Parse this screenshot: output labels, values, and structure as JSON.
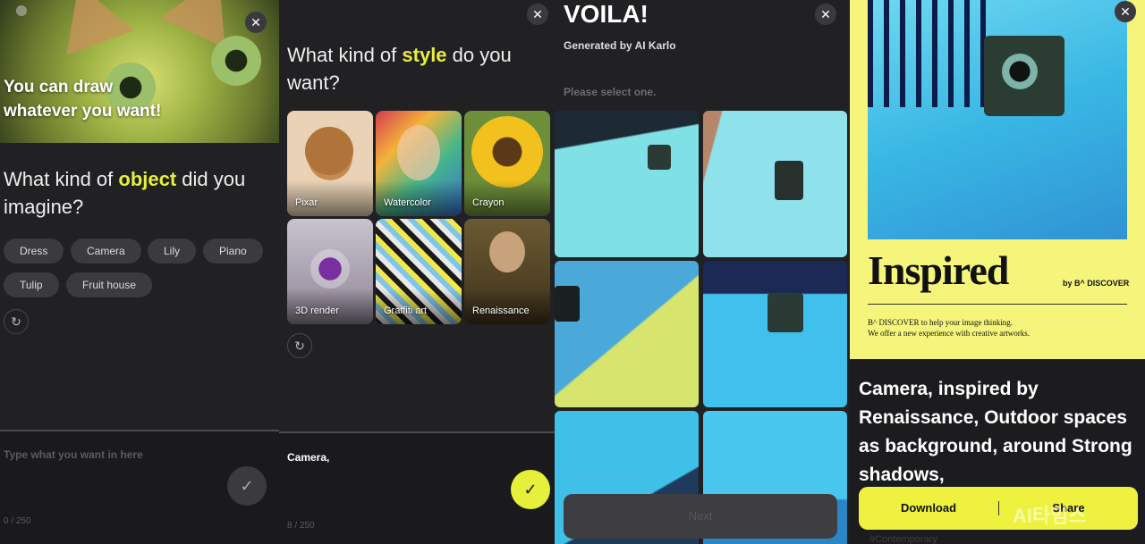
{
  "colors": {
    "accent": "#e6ef3a",
    "panel_bg": "#212124",
    "chip_bg": "#3a3a3f",
    "poster_bg": "#f4f57a"
  },
  "screen1": {
    "hero_line1": "You can draw",
    "hero_line2": "whatever you want!",
    "q_pre": "What kind of ",
    "q_hl": "object",
    "q_post": " did you imagine?",
    "chips": [
      "Dress",
      "Camera",
      "Lily",
      "Piano",
      "Tulip",
      "Fruit house"
    ],
    "placeholder": "Type what you want in here",
    "counter": "0 / 250",
    "close": "✕",
    "reset": "↻",
    "check": "✓"
  },
  "screen2": {
    "q_pre": "What kind of ",
    "q_hl": "style",
    "q_post": " do you want?",
    "styles": [
      "Pixar",
      "Watercolor",
      "Crayon",
      "3D render",
      "Graffiti art",
      "Renaissance"
    ],
    "input_value": "Camera,",
    "counter": "8 / 250",
    "close": "✕",
    "reset": "↻",
    "check": "✓"
  },
  "screen3": {
    "title": "VOILA!",
    "subtitle": "Generated by AI Karlo",
    "instruction": "Please select one.",
    "next_label": "Next",
    "close": "✕"
  },
  "screen4": {
    "poster_title": "Inspired",
    "poster_by": "by B^ DISCOVER",
    "poster_line1": "B^ DISCOVER to help your image thinking.",
    "poster_line2": "We offer a new experience with creative artworks.",
    "caption": "Camera, inspired by Renaissance, Outdoor spaces as background, around Strong shadows,",
    "download_label": "Download",
    "share_label": "Share",
    "hashtag": "#Contemporary",
    "watermark": "AI타임스",
    "close": "✕"
  }
}
